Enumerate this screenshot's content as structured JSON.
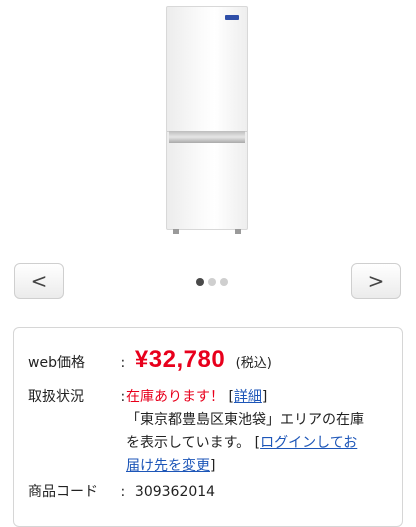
{
  "carousel": {
    "prev_label": "<",
    "next_label": ">",
    "dots": [
      true,
      false,
      false
    ]
  },
  "product": {
    "price_label": "web価格",
    "price_value": "¥32,780",
    "tax_note": "(税込)",
    "status_label": "取扱状況",
    "stock_text": "在庫あります！",
    "detail_open": "[",
    "detail_link": "詳細",
    "detail_close": "]",
    "area_line1": "「東京都豊島区東池袋」エリアの在庫",
    "area_line2_text": "を表示しています。",
    "login_open": "[",
    "login_link_part1": "ログインしてお",
    "login_link_part2": "届け先を変更",
    "login_close": "]",
    "code_label": "商品コード",
    "code_value": "309362014"
  },
  "colors": {
    "price": "#e8001c",
    "link": "#1d56b8"
  }
}
